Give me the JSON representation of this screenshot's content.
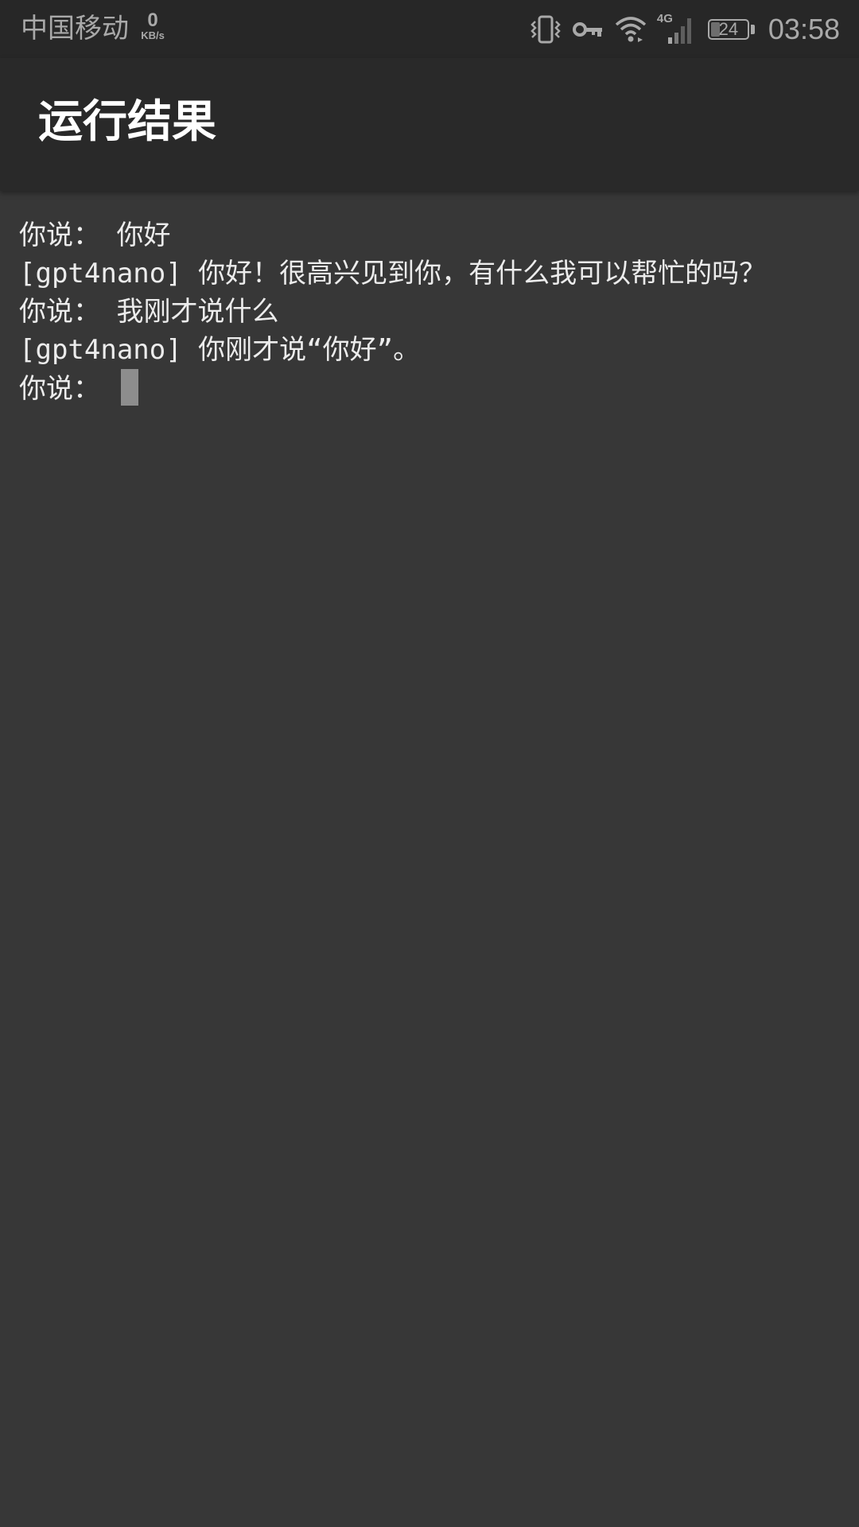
{
  "status_bar": {
    "carrier": "中国移动",
    "net_speed": "0",
    "net_speed_unit": "KB/s",
    "network_type": "4G",
    "battery_level": "24",
    "battery_fraction": 0.24,
    "time": "03:58",
    "icons": [
      "vibrate-icon",
      "vpn-key-icon",
      "wifi-icon",
      "cellular-signal-icon",
      "battery-icon"
    ]
  },
  "app_bar": {
    "title": "运行结果"
  },
  "terminal": {
    "lines": [
      "你说： 你好",
      "[gpt4nano] 你好！很高兴见到你，有什么我可以帮忙的吗？",
      "你说： 我刚才说什么",
      "[gpt4nano] 你刚才说“你好”。"
    ],
    "prompt": "你说： "
  },
  "colors": {
    "background": "#373737",
    "status_bar": "#272727",
    "app_bar": "#292929",
    "text": "#ececec",
    "cursor": "#8d8d8d"
  }
}
